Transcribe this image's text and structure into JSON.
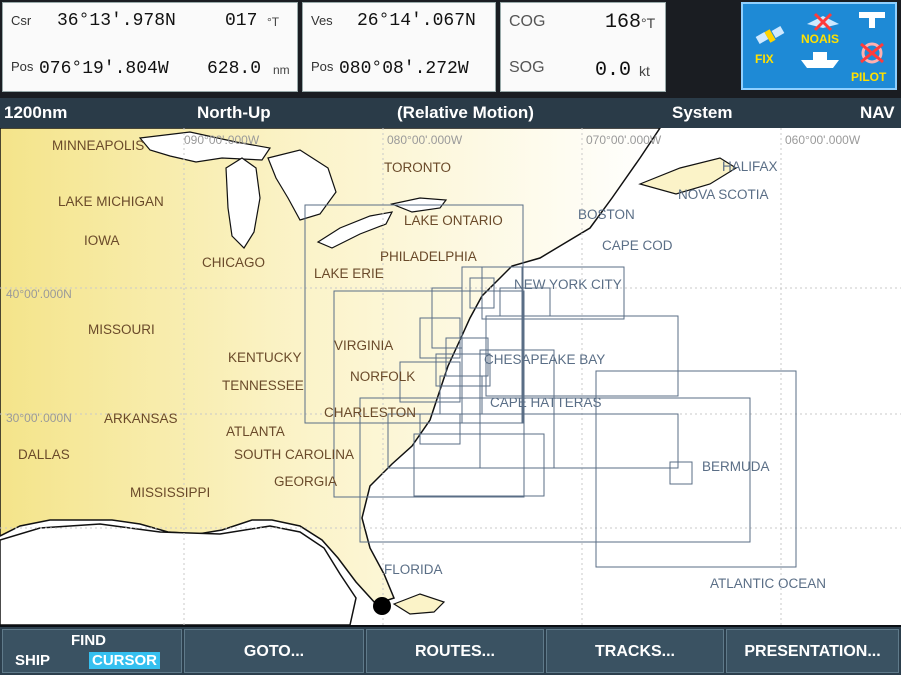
{
  "panels": {
    "cursor": {
      "label": "Csr",
      "lat": "36°13'.978N",
      "bearing": "017",
      "bearing_unit": "°T",
      "pos_label": "Pos",
      "lon": "076°19'.804W",
      "range": "628.0",
      "range_unit": "nm"
    },
    "vessel": {
      "label": "Ves",
      "lat": "26°14'.067N",
      "pos_label": "Pos",
      "lon": "080°08'.272W"
    },
    "cog": {
      "cog_label": "COG",
      "cog_value": "168",
      "cog_unit": "°T",
      "sog_label": "SOG",
      "sog_value": "0.0",
      "sog_unit": "kt"
    }
  },
  "pilot_panel": {
    "fix": "FIX",
    "noais": "NOAIS",
    "pilot": "PILOT"
  },
  "status_bar": {
    "range": "1200nm",
    "orientation": "North-Up",
    "motion": "(Relative Motion)",
    "mode": "System",
    "nav": "NAV"
  },
  "grid_labels": [
    "090°00'.000W",
    "080°00'.000W",
    "070°00'.000W",
    "060°00'.000W",
    "40°00'.000N",
    "30°00'.000N"
  ],
  "places": [
    "MINNEAPOLIS",
    "TORONTO",
    "HALIFAX",
    "NOVA SCOTIA",
    "LAKE MICHIGAN",
    "LAKE ONTARIO",
    "BOSTON",
    "IOWA",
    "PHILADELPHIA",
    "CAPE COD",
    "CHICAGO",
    "LAKE ERIE",
    "NEW YORK CITY",
    "MISSOURI",
    "KENTUCKY",
    "VIRGINIA",
    "CHESAPEAKE BAY",
    "TENNESSEE",
    "NORFOLK",
    "ARKANSAS",
    "CHARLESTON",
    "CAPE HATTERAS",
    "ATLANTA",
    "DALLAS",
    "SOUTH CAROLINA",
    "BERMUDA",
    "GEORGIA",
    "MISSISSIPPI",
    "FLORIDA",
    "ATLANTIC OCEAN"
  ],
  "softkeys": {
    "ship": "SHIP",
    "find": "FIND",
    "cursor": "CURSOR",
    "goto": "GOTO...",
    "routes": "ROUTES...",
    "tracks": "TRACKS...",
    "presentation": "PRESENTATION..."
  },
  "colors": {
    "land": "#f4ea9a",
    "land_west": "#f3e28a",
    "water": "#ffffff",
    "chart_box": "#5a6e86",
    "status_bar": "#2a3b48",
    "pilot_bg": "#1e8ad6"
  }
}
